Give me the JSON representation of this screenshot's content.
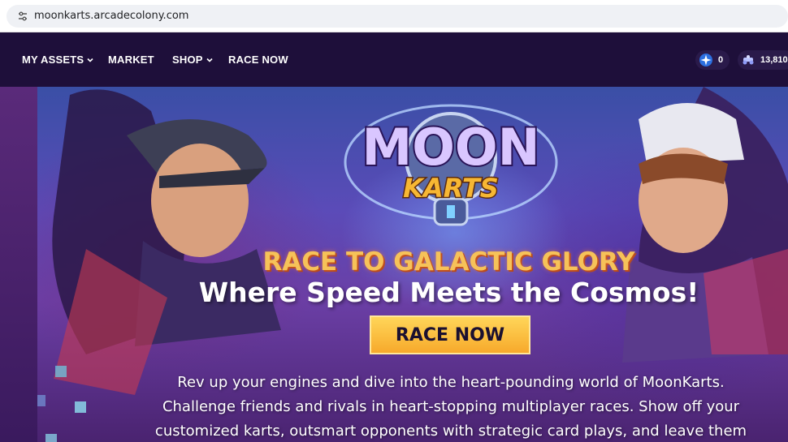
{
  "browser": {
    "url": "moonkarts.arcadecolony.com"
  },
  "nav": {
    "items": [
      {
        "label": "MY ASSETS",
        "dropdown": true
      },
      {
        "label": "MARKET",
        "dropdown": false
      },
      {
        "label": "SHOP",
        "dropdown": true
      },
      {
        "label": "RACE NOW",
        "dropdown": false
      }
    ],
    "stars_count": "0",
    "kart_count": "13,810"
  },
  "hero": {
    "logo_line1": "MOON",
    "logo_line2": "KARTS",
    "tagline": "RACE TO GALACTIC GLORY",
    "subtitle": "Where Speed Meets the Cosmos!",
    "cta_label": "RACE NOW",
    "description_lines": [
      "Rev up your engines and dive into the heart-pounding world of MoonKarts.",
      "Challenge friends and rivals in heart-stopping multiplayer races. Show off your",
      "customized karts, outsmart opponents with strategic card plays, and leave them"
    ]
  },
  "colors": {
    "nav_bg": "#1e0f3a",
    "accent_gold": "#f6c259",
    "cta_yellow": "#ffd659"
  },
  "icons": [
    "site-info-icon",
    "chevron-down-icon",
    "star-coin-icon",
    "kart-icon"
  ]
}
